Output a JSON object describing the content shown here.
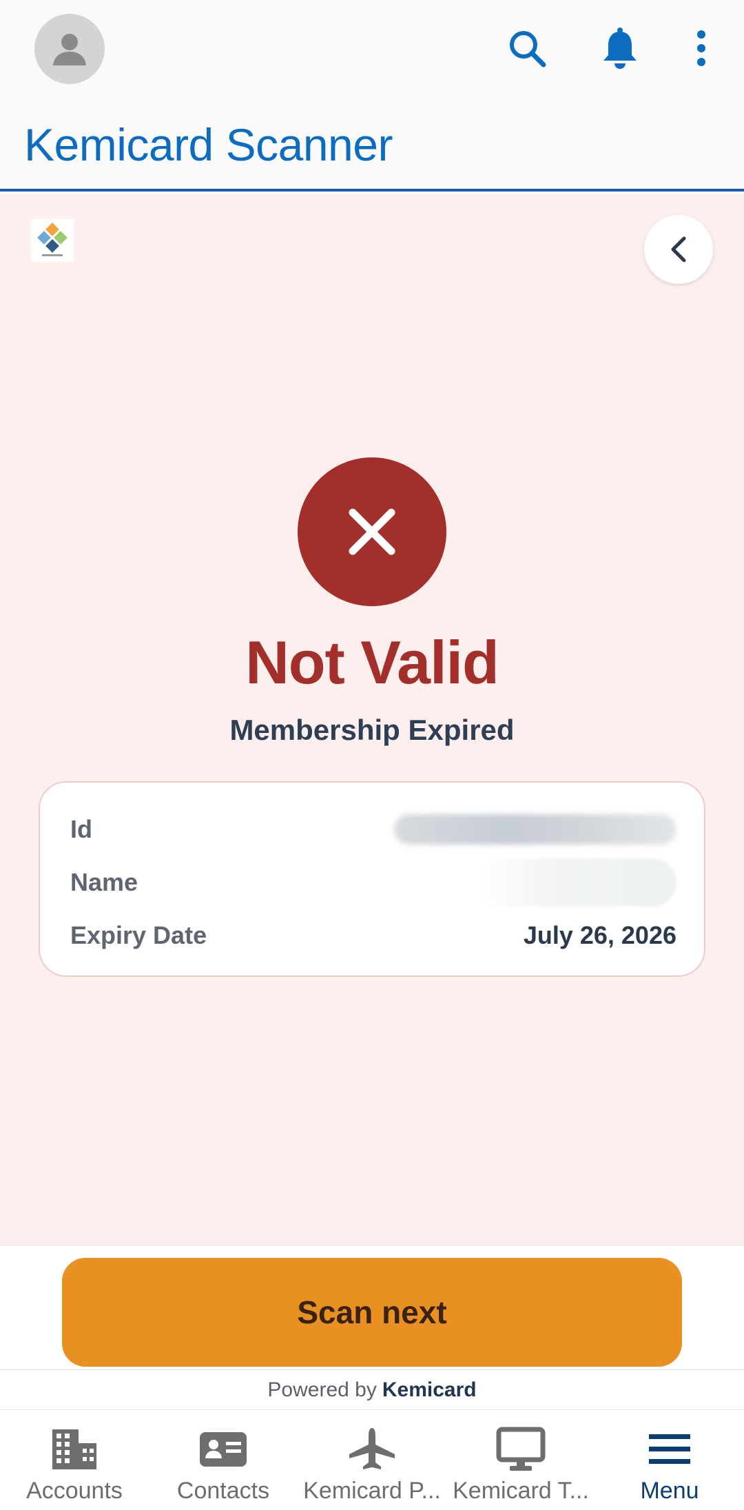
{
  "header": {
    "title": "Kemicard Scanner",
    "icons": [
      "avatar-icon",
      "search-icon",
      "bell-icon",
      "more-vertical-icon"
    ]
  },
  "result": {
    "status_title": "Not Valid",
    "status_subtitle": "Membership Expired",
    "status_icon": "close-icon",
    "card": {
      "rows": [
        {
          "label": "Id",
          "value": ""
        },
        {
          "label": "Name",
          "value": ""
        },
        {
          "label": "Expiry Date",
          "value": "July 26, 2026"
        }
      ]
    }
  },
  "actions": {
    "scan_next_label": "Scan next"
  },
  "footer": {
    "powered_prefix": "Powered by",
    "powered_brand": "Kemicard"
  },
  "nav": {
    "items": [
      {
        "label": "Accounts",
        "icon": "building-icon"
      },
      {
        "label": "Contacts",
        "icon": "contact-card-icon"
      },
      {
        "label": "Kemicard P...",
        "icon": "airplane-icon"
      },
      {
        "label": "Kemicard T...",
        "icon": "monitor-icon"
      },
      {
        "label": "Menu",
        "icon": "menu-icon"
      }
    ]
  },
  "colors": {
    "brand_blue": "#0b6cc0",
    "invalid_red": "#a32f2b",
    "panel_bg": "#fcefee",
    "accent_orange": "#e89122",
    "nav_active": "#0a3d72"
  }
}
